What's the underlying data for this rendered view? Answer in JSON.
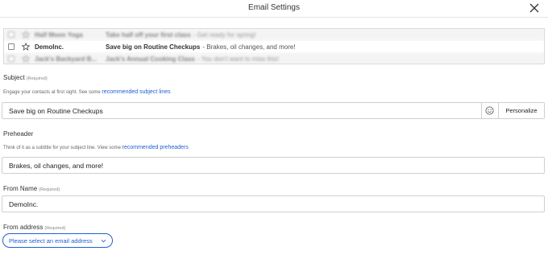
{
  "header": {
    "title": "Email Settings"
  },
  "preview": {
    "rows": [
      {
        "sender": "Half Moon Yoga",
        "subject": "Take half off your first class",
        "snippet": "- Get ready for spring!"
      },
      {
        "sender": "DemoInc.",
        "subject": "Save big on Routine Checkups",
        "snippet": "- Brakes, oil changes, and more!"
      },
      {
        "sender": "Jack's Backyard B...",
        "subject": "Jack's Annual Cooking Class",
        "snippet": "- You don't want to miss this!"
      }
    ]
  },
  "subject": {
    "label": "Subject",
    "required": "(Required)",
    "helper_text": "Engage your contacts at first sight. See some",
    "helper_link": "recommended subject lines",
    "value": "Save big on Routine Checkups",
    "personalize_label": "Personalize"
  },
  "preheader": {
    "label": "Preheader",
    "helper_text": "Think of it as a subtitle for your subject line. View some",
    "helper_link": "recommended preheaders",
    "value": "Brakes, oil changes, and more!"
  },
  "from_name": {
    "label": "From Name",
    "required": "(Required)",
    "value": "DemoInc."
  },
  "from_address": {
    "label": "From address",
    "required": "(Required)",
    "select_label": "Please select an email address"
  },
  "colors": {
    "link": "#1f5fcf",
    "border": "#cfcfcf"
  }
}
